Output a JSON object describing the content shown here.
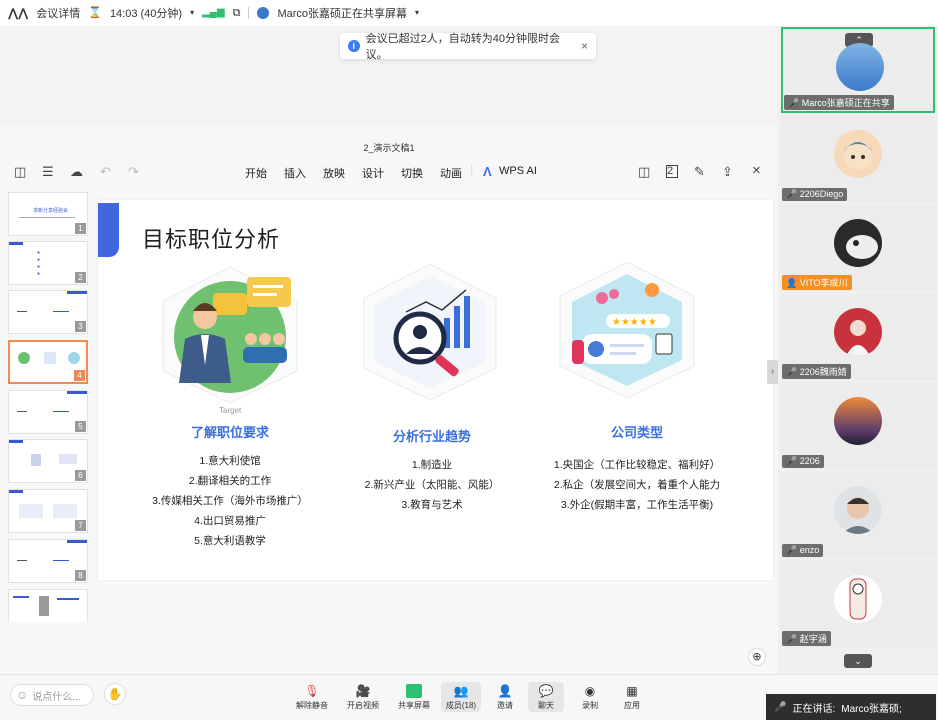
{
  "topbar": {
    "meeting_info": "会议详情",
    "time": "14:03 (40分钟)",
    "sharer": "Marco张嘉硕正在共享屏幕"
  },
  "notice": {
    "text": "会议已超过2人，自动转为40分钟限时会议。"
  },
  "wps": {
    "doc_title": "2_演示文稿1",
    "menu": [
      "开始",
      "插入",
      "放映",
      "设计",
      "切换",
      "动画"
    ],
    "ai_label": "WPS AI"
  },
  "thumbnails": {
    "numbers": [
      "1",
      "2",
      "3",
      "4",
      "5",
      "6",
      "7",
      "8"
    ],
    "slide1_title": "求新分享经验会",
    "active": "4"
  },
  "slide": {
    "title": "目标职位分析",
    "target_label": "Target",
    "columns": [
      {
        "heading": "了解职位要求",
        "items": [
          "1.意大利使馆",
          "2.翻译相关的工作",
          "3.传媒相关工作（海外市场推广）",
          "4.出口贸易推广",
          "5.意大利语教学"
        ]
      },
      {
        "heading": "分析行业趋势",
        "items": [
          "1.制造业",
          "2.新兴产业（太阳能、风能）",
          "3.教育与艺术"
        ]
      },
      {
        "heading": "公司类型",
        "items": [
          "1.央国企（工作比较稳定、福利好）",
          "2.私企（发展空间大，着重个人能力",
          "3.外企(假期丰富，工作生活平衡)"
        ]
      }
    ]
  },
  "participants": [
    {
      "name": "Marco张嘉硕正在共享",
      "active": true
    },
    {
      "name": "2206Diego"
    },
    {
      "name": "VITO李成川",
      "host": true
    },
    {
      "name": "2206魏雨婧"
    },
    {
      "name": "2206"
    },
    {
      "name": "enzo"
    },
    {
      "name": "赵宇涵"
    }
  ],
  "bottombar": {
    "chat_placeholder": "说点什么...",
    "buttons": [
      "解除静音",
      "开启视频",
      "共享屏幕",
      "成员(18)",
      "邀请",
      "聊天",
      "录制",
      "应用"
    ],
    "speaking_label": "正在讲话:",
    "speaking_name": "Marco张嘉硕;"
  },
  "colors": {
    "accent_blue": "#3c6fe0",
    "active_green": "#2fbf71",
    "thumb_active": "#ef8a54"
  }
}
